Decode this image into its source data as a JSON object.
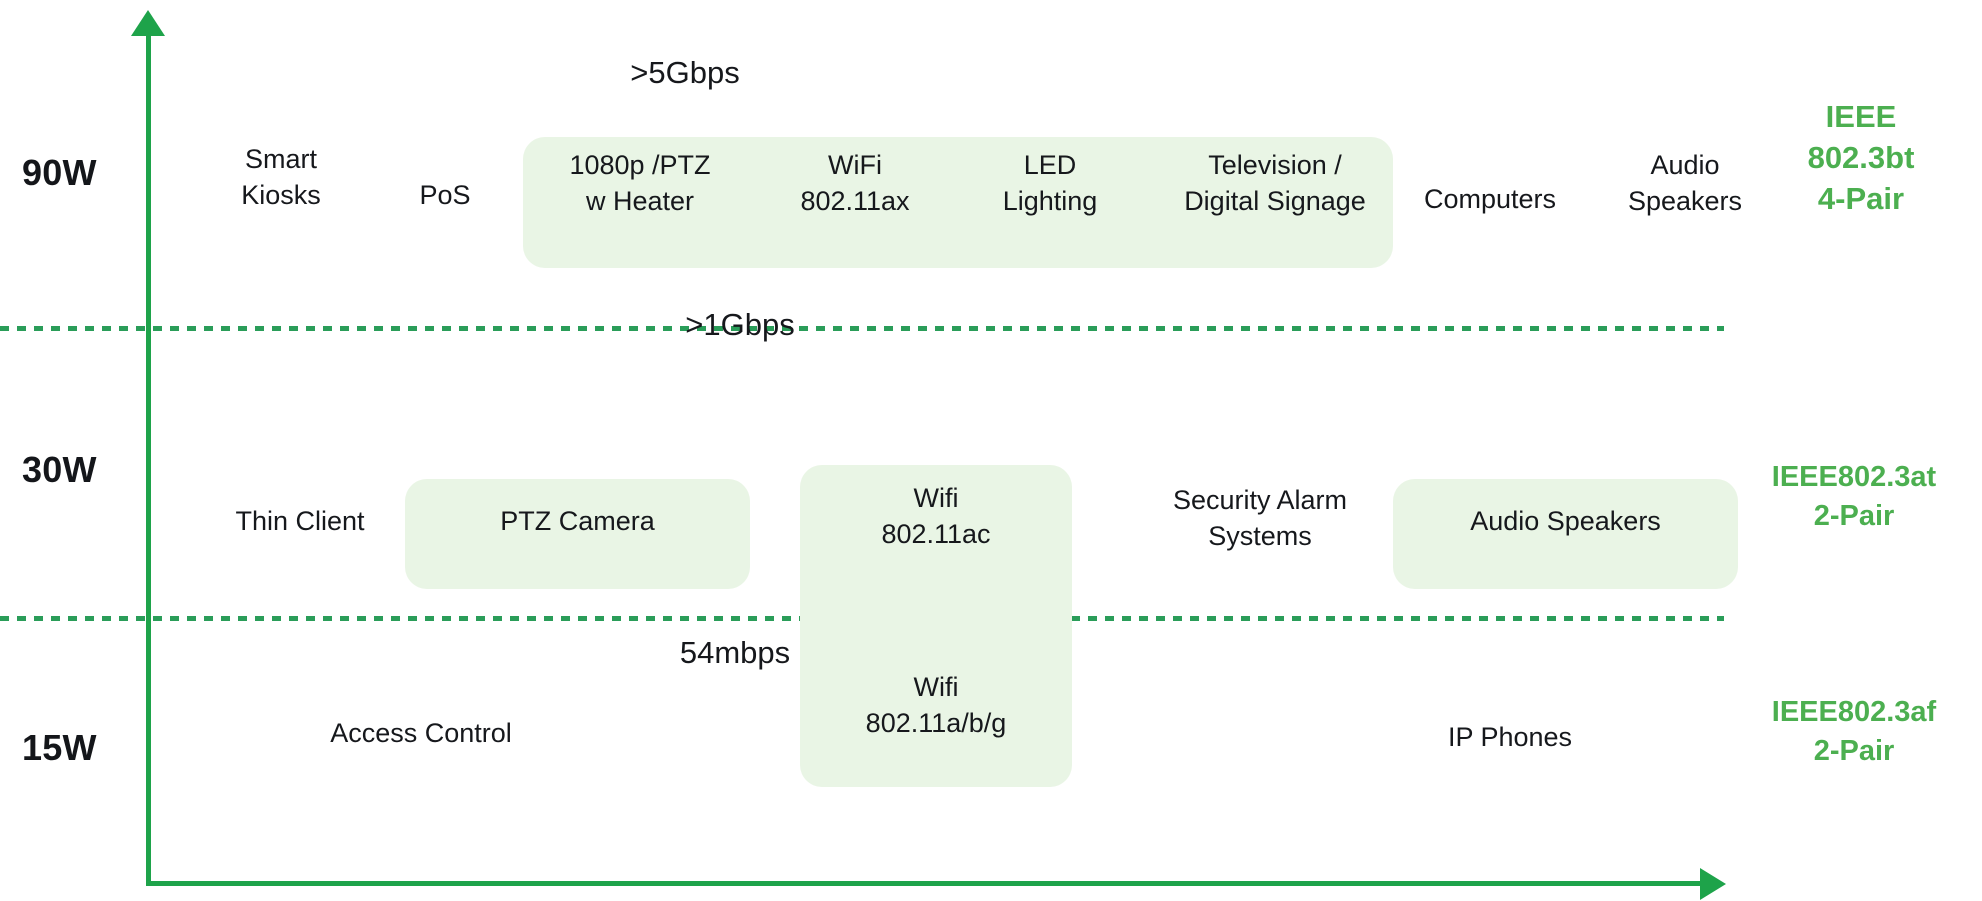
{
  "axes": {
    "vertical_axis": "power-axis",
    "horizontal_axis": "bandwidth-axis",
    "accent_color": "#1ea34a",
    "pill_color": "#e9f5e5",
    "standard_text_color": "#4caf50"
  },
  "tiers": [
    {
      "power": "90W",
      "standard": {
        "lines": [
          "IEEE",
          "802.3bt",
          "4-Pair"
        ]
      },
      "speed": ">5Gbps",
      "items": [
        {
          "lines": [
            "Smart",
            "Kiosks"
          ],
          "highlighted": false
        },
        {
          "lines": [
            "PoS"
          ],
          "highlighted": false
        },
        {
          "lines": [
            "1080p /PTZ",
            "w Heater"
          ],
          "highlighted": true
        },
        {
          "lines": [
            "WiFi",
            "802.11ax"
          ],
          "highlighted": true
        },
        {
          "lines": [
            "LED",
            "Lighting"
          ],
          "highlighted": true
        },
        {
          "lines": [
            "Television /",
            "Digital Signage"
          ],
          "highlighted": true
        },
        {
          "lines": [
            "Computers"
          ],
          "highlighted": false
        },
        {
          "lines": [
            "Audio",
            "Speakers"
          ],
          "highlighted": false
        }
      ]
    },
    {
      "power": "30W",
      "standard": {
        "lines": [
          "IEEE802.3at",
          "2-Pair"
        ]
      },
      "speed": ">1Gbps",
      "items": [
        {
          "lines": [
            "Thin Client"
          ],
          "highlighted": false
        },
        {
          "lines": [
            "PTZ Camera"
          ],
          "highlighted": true
        },
        {
          "lines": [
            "Wifi",
            "802.11ac"
          ],
          "highlighted": true
        },
        {
          "lines": [
            "Security Alarm",
            "Systems"
          ],
          "highlighted": false
        },
        {
          "lines": [
            "Audio Speakers"
          ],
          "highlighted": true
        }
      ]
    },
    {
      "power": "15W",
      "standard": {
        "lines": [
          "IEEE802.3af",
          "2-Pair"
        ]
      },
      "speed": "54mbps",
      "items": [
        {
          "lines": [
            "Access Control"
          ],
          "highlighted": false
        },
        {
          "lines": [
            "Wifi",
            "802.11a/b/g"
          ],
          "highlighted": true
        },
        {
          "lines": [
            "IP Phones"
          ],
          "highlighted": false
        }
      ]
    }
  ]
}
